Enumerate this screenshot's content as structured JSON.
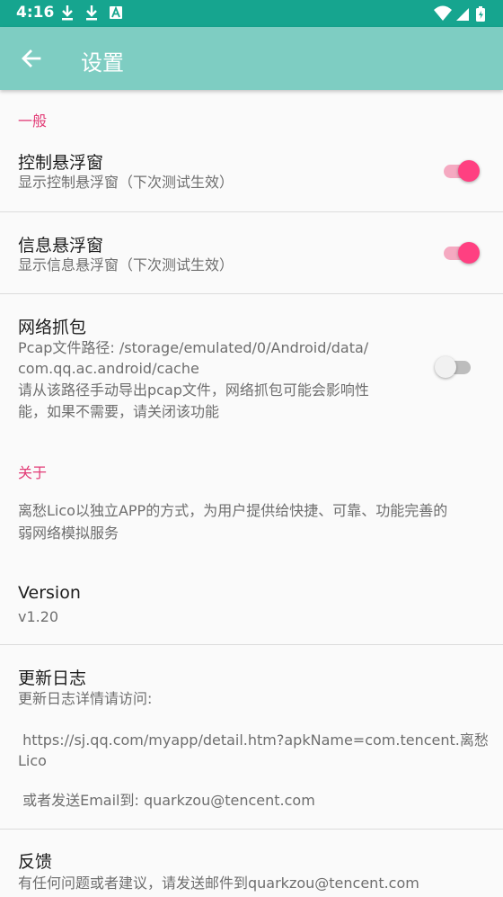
{
  "status_bar": {
    "time": "4:16",
    "notifications": [
      "download-icon",
      "download-icon",
      "a-letter-icon"
    ],
    "system_icons": [
      "wifi-icon",
      "signal-icon",
      "battery-icon"
    ]
  },
  "app_bar": {
    "title": "设置",
    "background": "#7ecdc2",
    "status_color": "#16a58f"
  },
  "accent_color": "#ff4081",
  "sections": {
    "general": {
      "header": "一般",
      "control_float": {
        "title": "控制悬浮窗",
        "summary": "显示控制悬浮窗（下次测试生效）",
        "enabled": true
      },
      "info_float": {
        "title": "信息悬浮窗",
        "summary": "显示信息悬浮窗（下次测试生效）",
        "enabled": true
      },
      "capture": {
        "title": "网络抓包",
        "summary_line1": "Pcap文件路径: /storage/emulated/0/Android/data/",
        "summary_line2": "com.qq.ac.android/cache",
        "summary_line3": "请从该路径手动导出pcap文件，网络抓包可能会影响性",
        "summary_line4": "能，如果不需要，请关闭该功能",
        "enabled": false
      }
    },
    "about": {
      "header": "关于",
      "description_line1": "离愁Lico以独立APP的方式，为用户提供给快捷、可靠、功能完善的",
      "description_line2": "弱网络模拟服务",
      "version": {
        "title": "Version",
        "value": "v1.20"
      },
      "changelog": {
        "title": "更新日志",
        "line1": "更新日志详情请访问:",
        "line2": " https://sj.qq.com/myapp/detail.htm?apkName=com.tencent.离愁",
        "line3": "Lico",
        "line4": " 或者发送Email到: quarkzou@tencent.com"
      },
      "feedback": {
        "title": "反馈",
        "summary": "有任何问题或者建议，请发送邮件到quarkzou@tencent.com"
      }
    }
  }
}
